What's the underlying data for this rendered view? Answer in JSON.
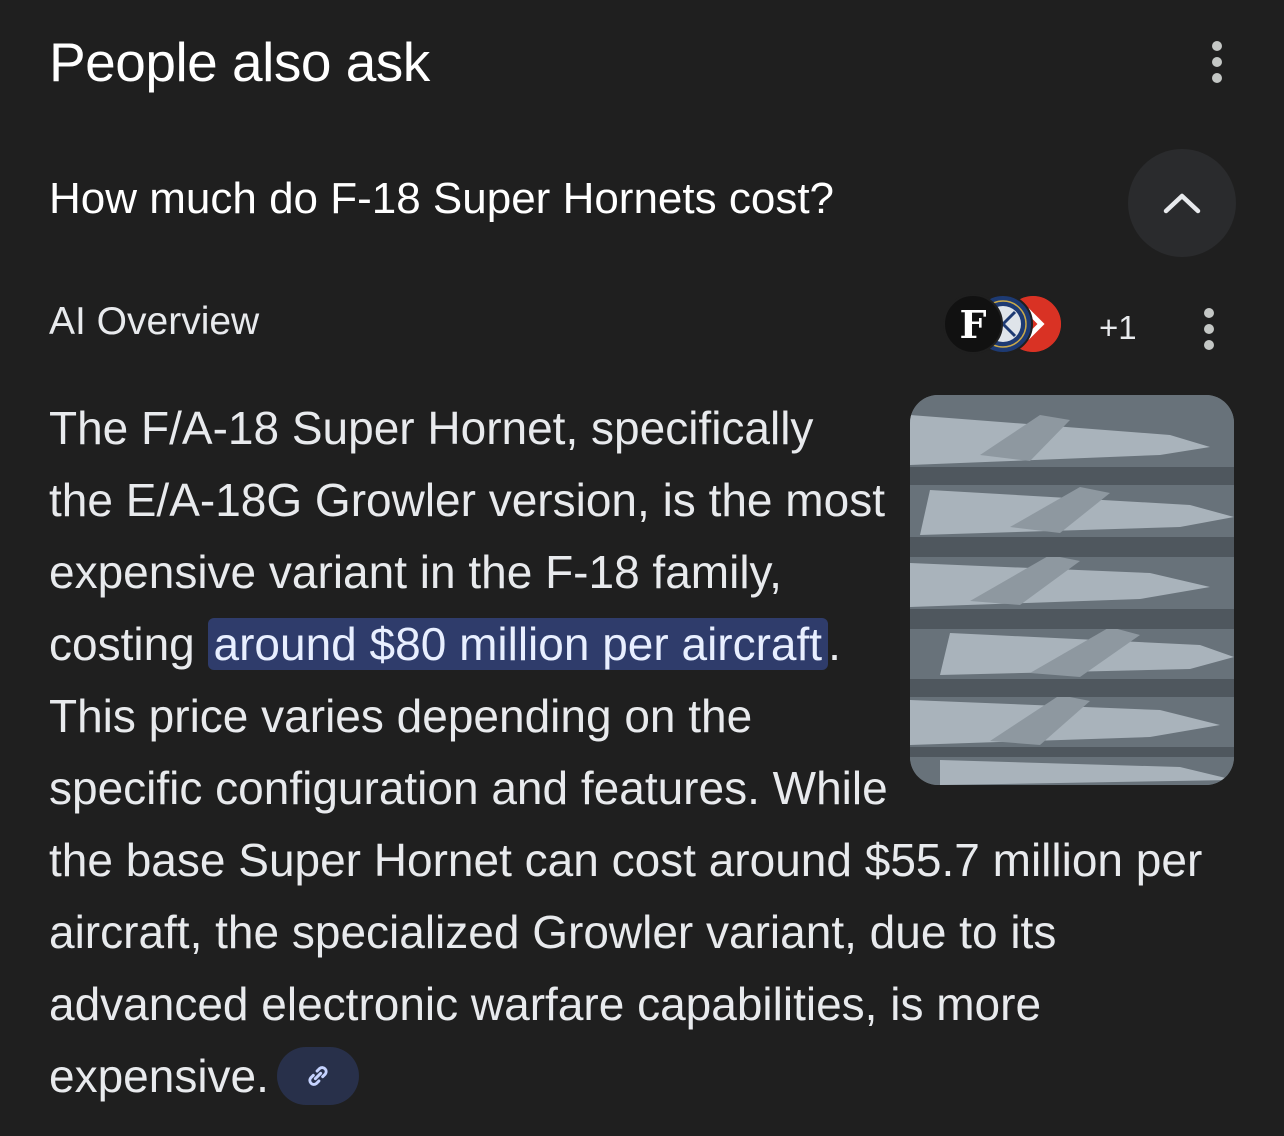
{
  "header": {
    "title": "People also ask"
  },
  "question": {
    "text": "How much do F-18 Super Hornets cost?"
  },
  "ai_overview": {
    "label": "AI Overview",
    "sources": {
      "icons": [
        "source-f-icon",
        "source-navy-seal-icon",
        "source-red-chevron-icon"
      ],
      "f_letter": "F",
      "more_count": "+1"
    }
  },
  "answer": {
    "part1": "The F/A-18 Super Hornet, specifically the E/A-18G Growler version, is the most expensive variant in the F-18 family, costing ",
    "highlight": "around $80 million per aircraft",
    "part2": ". This price varies depending on the specific configuration and features. While the base Super Hornet can cost around $55.7 million per aircraft, the specialized Growler variant, due to its advanced electronic warfare capabilities, is more expensive."
  },
  "colors": {
    "background": "#1f1f1f",
    "highlight": "#2f3c6b",
    "link_chip": "#28304a",
    "collapse_button": "#2a2b2d"
  }
}
